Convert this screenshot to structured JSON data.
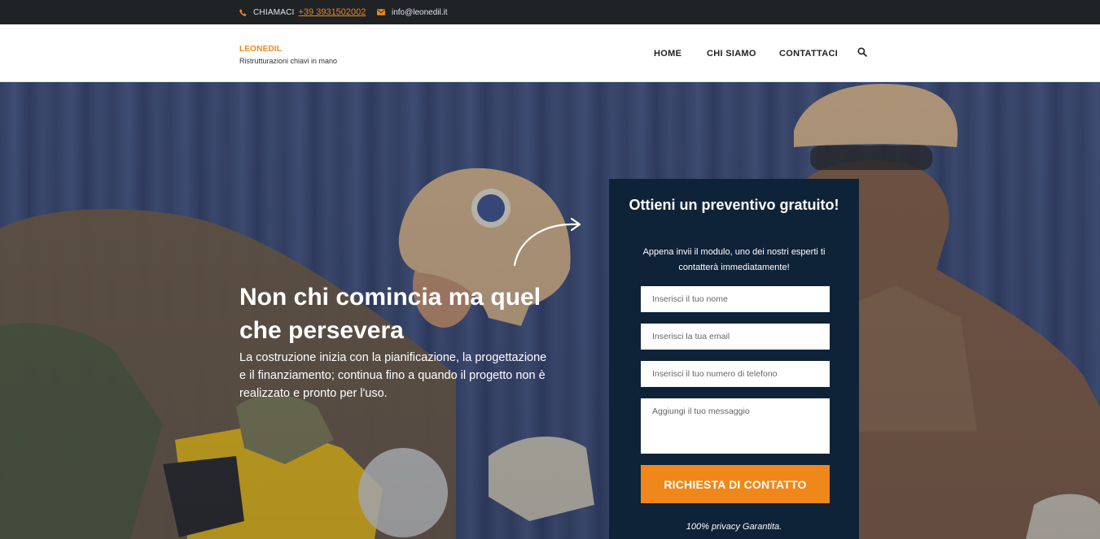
{
  "topbar": {
    "phone_icon": "phone-icon",
    "call_label": "CHIAMACI",
    "phone": "+39 3931502002",
    "mail_icon": "envelope-icon",
    "email": "info@leonedil.it"
  },
  "header": {
    "brand_name": "LEONEDIL",
    "tagline": "Ristrutturazioni chiavi in mano",
    "nav": {
      "home": "HOME",
      "about": "CHI SIAMO",
      "contact": "CONTATTACI"
    },
    "search_icon": "search-icon"
  },
  "hero": {
    "title": "Non chi comincia ma quel che persevera",
    "text": "La costruzione inizia con la pianificazione, la progettazione e il finanziamento; continua fino a quando il progetto non è realizzato e pronto per l'uso."
  },
  "form": {
    "title": "Ottieni un preventivo gratuito!",
    "subtitle": "Appena invii il modulo, uno dei nostri esperti ti contatterà immediatamente!",
    "name_placeholder": "Inserisci il tuo nome",
    "email_placeholder": "Inserisci la tua email",
    "phone_placeholder": "Inserisci il tuo numero di telefono",
    "message_placeholder": "Aggiungi il tuo messaggio",
    "submit_label": "RICHIESTA DI CONTATTO",
    "privacy": "100% privacy Garantita."
  },
  "colors": {
    "accent": "#f0871a",
    "topbar": "#1f2326",
    "panel": "#0e2238"
  }
}
